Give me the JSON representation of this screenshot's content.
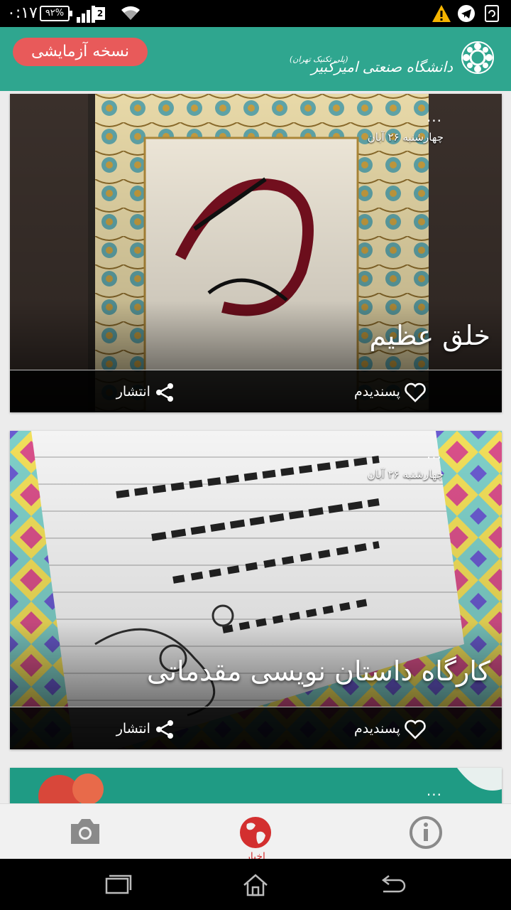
{
  "status_bar": {
    "time": "۰:۱۷",
    "battery": "۹۲%",
    "sim_slot": "2",
    "icons": [
      "signal-icon",
      "wifi-icon",
      "warning-icon",
      "telegram-icon",
      "sync-icon"
    ]
  },
  "header": {
    "trial_label": "نسخه آزمایشی",
    "logo_main": "دانشگاه صنعتی امیرکبیر",
    "logo_sub": "(پلی تکنیک تهران)",
    "colors": {
      "bar": "#2fa68f",
      "trial": "#e85a5a"
    }
  },
  "feed": {
    "more_symbol": "...",
    "items": [
      {
        "date": "چهارشنبه ۲۶ آبان",
        "title": "خلق عظیم",
        "like_label": "پسندیدم",
        "share_label": "انتشار"
      },
      {
        "date": "چهارشنبه ۲۶ آبان",
        "title": "کارگاه داستان نویسی مقدماتی",
        "like_label": "پسندیدم",
        "share_label": "انتشار"
      }
    ]
  },
  "bottom_nav": {
    "items": [
      {
        "icon": "camera-icon"
      },
      {
        "icon": "globe-icon",
        "label": "اخبار",
        "active": true
      },
      {
        "icon": "info-icon"
      }
    ],
    "active_color": "#d32f2f"
  },
  "system_nav": [
    "recent-apps-icon",
    "home-icon",
    "back-icon"
  ]
}
